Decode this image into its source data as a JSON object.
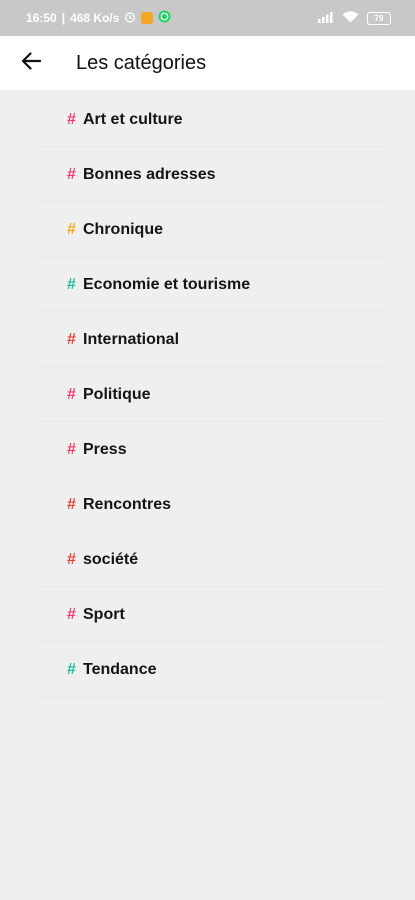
{
  "status_bar": {
    "time": "16:50",
    "separator": "|",
    "network_speed": "468 Ko/s",
    "battery_level": "79",
    "icons": [
      "alarm-icon",
      "app-notification-icon",
      "whatsapp-icon",
      "signal-icon",
      "wifi-icon",
      "battery-icon"
    ]
  },
  "header": {
    "back_icon": "arrow-left-icon",
    "title": "Les catégories"
  },
  "categories": [
    {
      "hash": "#",
      "label": "Art et culture",
      "color": "#ef3f6a"
    },
    {
      "hash": "#",
      "label": "Bonnes adresses",
      "color": "#ef3f6a"
    },
    {
      "hash": "#",
      "label": "Chronique",
      "color": "#f5a623"
    },
    {
      "hash": "#",
      "label": "Economie et tourisme",
      "color": "#1bbc9b"
    },
    {
      "hash": "#",
      "label": "International",
      "color": "#e8453c"
    },
    {
      "hash": "#",
      "label": "Politique",
      "color": "#ef3f6a"
    },
    {
      "hash": "#",
      "label": "Press",
      "color": "#ef3f6a"
    },
    {
      "hash": "#",
      "label": "Rencontres",
      "color": "#e8453c"
    },
    {
      "hash": "#",
      "label": "société",
      "color": "#e8453c"
    },
    {
      "hash": "#",
      "label": "Sport",
      "color": "#ef3f6a"
    },
    {
      "hash": "#",
      "label": "Tendance",
      "color": "#1bbc9b"
    }
  ],
  "colors": {
    "background": "#efefef",
    "status_bar": "#c8c8c8",
    "app_bar": "#ffffff",
    "notification_badge": "#f5a623",
    "whatsapp_badge": "#25d366"
  }
}
